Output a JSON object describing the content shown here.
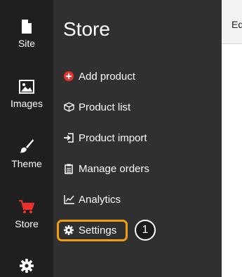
{
  "rail": {
    "items": [
      {
        "label": "Site",
        "icon": "page-icon"
      },
      {
        "label": "Images",
        "icon": "image-icon"
      },
      {
        "label": "Theme",
        "icon": "brush-icon"
      },
      {
        "label": "Store",
        "icon": "cart-icon",
        "active": true
      },
      {
        "label": "",
        "icon": "gear-icon"
      }
    ]
  },
  "panel": {
    "title": "Store",
    "menu": [
      {
        "label": "Add product",
        "icon": "plus-circle-icon"
      },
      {
        "label": "Product list",
        "icon": "box-icon"
      },
      {
        "label": "Product import",
        "icon": "import-icon"
      },
      {
        "label": "Manage orders",
        "icon": "clipboard-icon"
      },
      {
        "label": "Analytics",
        "icon": "line-chart-icon"
      },
      {
        "label": "Settings",
        "icon": "gear-icon"
      }
    ]
  },
  "callout": {
    "number": "1"
  },
  "content": {
    "header_text": "Ed"
  },
  "colors": {
    "rail_bg": "#1f1f1f",
    "panel_bg": "#303030",
    "active_red": "#e8322e",
    "highlight_orange": "#f39c12"
  }
}
